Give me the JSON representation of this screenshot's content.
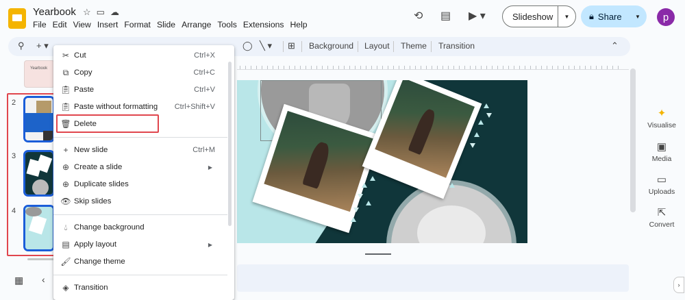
{
  "app": {
    "title": "Yearbook",
    "menus": [
      "File",
      "Edit",
      "View",
      "Insert",
      "Format",
      "Slide",
      "Arrange",
      "Tools",
      "Extensions",
      "Help"
    ],
    "avatar_letter": "p"
  },
  "header": {
    "slideshow_label": "Slideshow",
    "share_label": "Share"
  },
  "toolbar": {
    "background_label": "Background",
    "layout_label": "Layout",
    "theme_label": "Theme",
    "transition_label": "Transition"
  },
  "filmstrip": {
    "thumb1_text": "Yearbook",
    "slide_numbers": [
      "2",
      "3",
      "4"
    ]
  },
  "side_panel": {
    "items": [
      "Visualise",
      "Media",
      "Uploads",
      "Convert"
    ]
  },
  "context_menu": {
    "items": [
      {
        "label": "Cut",
        "shortcut": "Ctrl+X"
      },
      {
        "label": "Copy",
        "shortcut": "Ctrl+C"
      },
      {
        "label": "Paste",
        "shortcut": "Ctrl+V"
      },
      {
        "label": "Paste without formatting",
        "shortcut": "Ctrl+Shift+V"
      },
      {
        "label": "Delete",
        "shortcut": ""
      },
      {
        "label": "New slide",
        "shortcut": "Ctrl+M"
      },
      {
        "label": "Create a slide",
        "shortcut": ""
      },
      {
        "label": "Duplicate slides",
        "shortcut": ""
      },
      {
        "label": "Skip slides",
        "shortcut": ""
      },
      {
        "label": "Change background",
        "shortcut": ""
      },
      {
        "label": "Apply layout",
        "shortcut": ""
      },
      {
        "label": "Change theme",
        "shortcut": ""
      },
      {
        "label": "Transition",
        "shortcut": ""
      }
    ]
  },
  "colors": {
    "accent": "#1a5dd9",
    "share_bg": "#c2e7ff",
    "highlight_red": "#e0454d",
    "slide_teal_light": "#b9e6e8",
    "slide_teal_dark": "#10363a"
  }
}
